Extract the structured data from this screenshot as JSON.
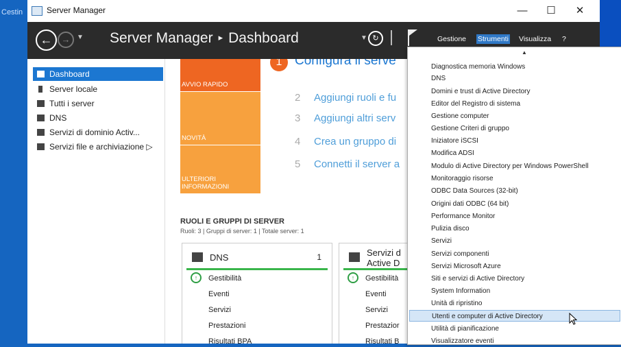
{
  "desktop": {
    "left_label": "Cestin"
  },
  "window": {
    "title": "Server Manager",
    "controls": {
      "minimize": "—",
      "maximize": "☐",
      "close": "✕"
    }
  },
  "header": {
    "breadcrumb_root": "Server Manager",
    "breadcrumb_sep": "▸",
    "breadcrumb_page": "Dashboard",
    "menu": {
      "manage": "Gestione",
      "tools": "Strumenti",
      "view": "Visualizza",
      "help": "?"
    }
  },
  "sidebar": {
    "items": [
      {
        "label": "Dashboard",
        "selected": true
      },
      {
        "label": "Server locale",
        "selected": false
      },
      {
        "label": "Tutti i server",
        "selected": false
      },
      {
        "label": "DNS",
        "selected": false
      },
      {
        "label": "Servizi di dominio Activ...",
        "selected": false
      },
      {
        "label": "Servizi file e archiviazione ▷",
        "selected": false
      }
    ]
  },
  "welcome": {
    "tiles": {
      "quick_start": "AVVIO RAPIDO",
      "news": "NOVITÀ",
      "more_info": "ULTERIORI INFORMAZIONI"
    },
    "steps": [
      {
        "num": "1",
        "label": "Configura il serve"
      },
      {
        "num": "2",
        "label": "Aggiungi ruoli e fu"
      },
      {
        "num": "3",
        "label": "Aggiungi altri serv"
      },
      {
        "num": "4",
        "label": "Crea un gruppo di"
      },
      {
        "num": "5",
        "label": "Connetti il server a"
      }
    ]
  },
  "roles": {
    "title": "RUOLI E GRUPPI DI SERVER",
    "summary": "Ruoli: 3  |  Gruppi di server: 1  |  Totale server: 1",
    "cards": [
      {
        "title": "DNS",
        "count": "1",
        "rows": [
          "Gestibilità",
          "Eventi",
          "Servizi",
          "Prestazioni",
          "Risultati BPA"
        ]
      },
      {
        "title": "Servizi d Active D",
        "count": "",
        "rows": [
          "Gestibilità",
          "Eventi",
          "Servizi",
          "Prestazior",
          "Risultati B"
        ]
      }
    ]
  },
  "tools_menu": {
    "items": [
      "Diagnostica memoria Windows",
      "DNS",
      "Domini e trust di Active Directory",
      "Editor del Registro di sistema",
      "Gestione computer",
      "Gestione Criteri di gruppo",
      "Iniziatore iSCSI",
      "Modifica ADSI",
      "Modulo di Active Directory per Windows PowerShell",
      "Monitoraggio risorse",
      "ODBC Data Sources (32-bit)",
      "Origini dati ODBC (64 bit)",
      "Performance Monitor",
      "Pulizia disco",
      "Servizi",
      "Servizi componenti",
      "Servizi Microsoft Azure",
      "Siti e servizi di Active Directory",
      "System Information",
      "Unità di ripristino",
      "Utenti e computer di Active Directory",
      "Utilità di pianificazione",
      "Visualizzatore eventi"
    ],
    "highlighted": "Utenti e computer di Active Directory"
  },
  "colors": {
    "header_bg": "#2b2b2b",
    "accent": "#1c77d1",
    "tile_orange_dark": "#ee6622",
    "tile_orange": "#f7a13e",
    "status_green": "#39b54a"
  },
  "icons": {
    "back": "back-arrow-icon",
    "forward": "forward-arrow-icon",
    "refresh": "refresh-icon",
    "flag": "notification-flag-icon",
    "dns": "dns-server-icon"
  }
}
